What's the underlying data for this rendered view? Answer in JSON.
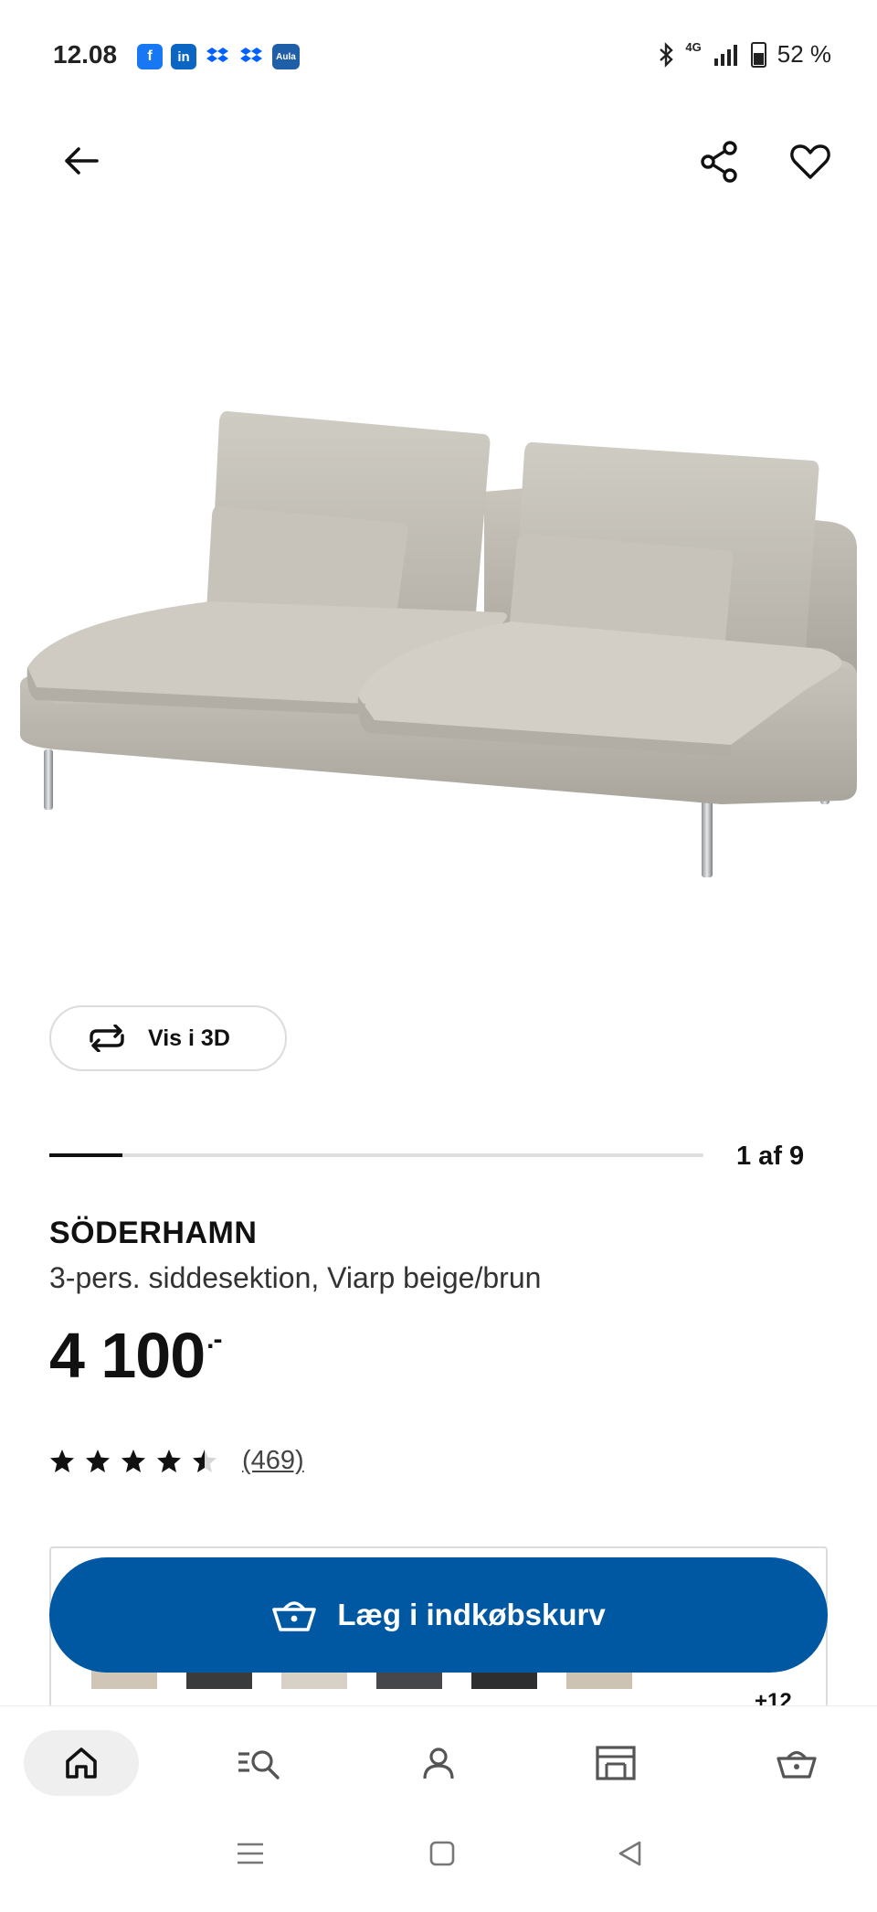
{
  "status_bar": {
    "time": "12.08",
    "apps": [
      {
        "icon": "facebook-icon",
        "label": "f",
        "color": "#1877f2"
      },
      {
        "icon": "linkedin-icon",
        "label": "in",
        "color": "#0a66c2"
      },
      {
        "icon": "dropbox-icon",
        "label": "",
        "color": "#0061ff"
      },
      {
        "icon": "dropbox-icon",
        "label": "",
        "color": "#0061ff"
      },
      {
        "icon": "aula-icon",
        "label": "Aula",
        "color": "#1f5fa8"
      }
    ],
    "network": "4G",
    "battery": "52 %"
  },
  "product": {
    "carousel": {
      "current": 1,
      "total": 9,
      "label": "1 af 9"
    },
    "view_3d_label": "Vis i 3D",
    "name": "SÖDERHAMN",
    "description": "3-pers. siddesektion, Viarp beige/brun",
    "price": "4 100",
    "price_suffix": ".-",
    "rating": {
      "stars": 4.5,
      "max": 5,
      "count_label": "(469)"
    },
    "add_to_cart_label": "Læg i indkøbskurv",
    "more_variants_label": "+12",
    "variant_colors": [
      "#cfc6b8",
      "#3a3b3d",
      "#d8d2c6",
      "#45474a",
      "#2d2e30",
      "#cdc3b2"
    ]
  },
  "tabs": [
    {
      "name": "home",
      "icon": "home-icon",
      "active": true
    },
    {
      "name": "search",
      "icon": "search-icon",
      "active": false
    },
    {
      "name": "profile",
      "icon": "profile-icon",
      "active": false
    },
    {
      "name": "stores",
      "icon": "store-icon",
      "active": false
    },
    {
      "name": "cart",
      "icon": "basket-icon",
      "active": false
    }
  ],
  "colors": {
    "accent": "#0058a3",
    "text": "#111111",
    "border": "#dcdcdc"
  }
}
